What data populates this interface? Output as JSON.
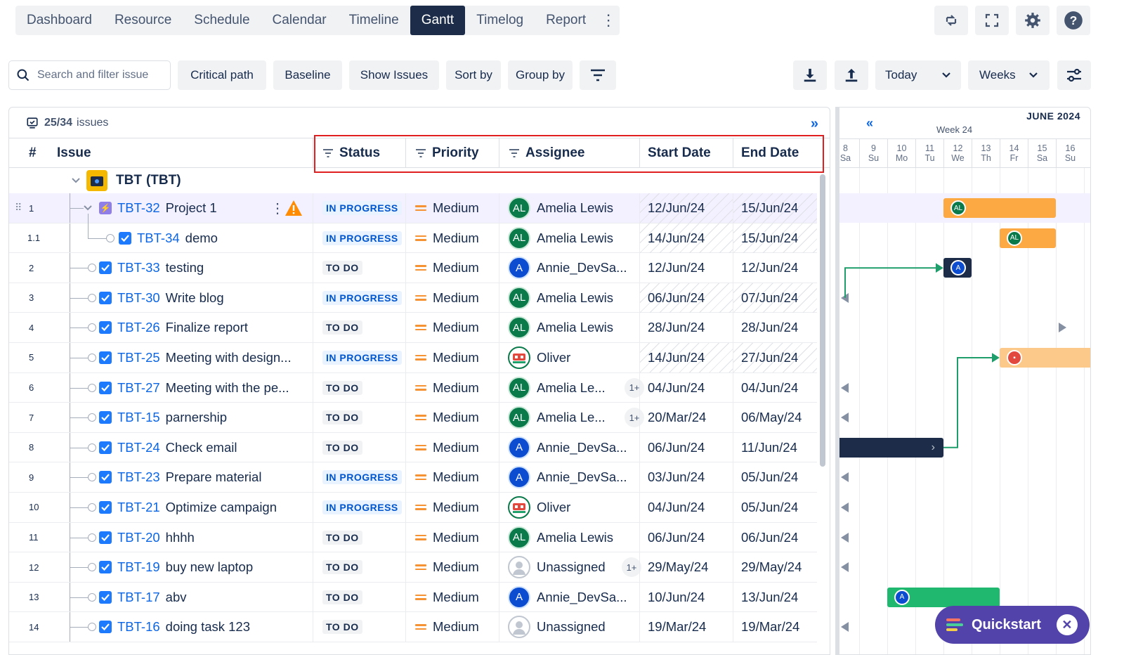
{
  "nav": {
    "tabs": [
      {
        "label": "Dashboard"
      },
      {
        "label": "Resource"
      },
      {
        "label": "Schedule"
      },
      {
        "label": "Calendar"
      },
      {
        "label": "Timeline"
      },
      {
        "label": "Gantt"
      },
      {
        "label": "Timelog"
      },
      {
        "label": "Report"
      }
    ],
    "active": "Gantt"
  },
  "toolbar": {
    "search_placeholder": "Search and filter issue",
    "critical_path": "Critical path",
    "baseline": "Baseline",
    "show_issues": "Show Issues",
    "sort_by": "Sort by",
    "group_by": "Group by",
    "today": "Today",
    "weeks": "Weeks"
  },
  "panel": {
    "count": "25/34",
    "count_suffix": "issues"
  },
  "columns": {
    "num": "#",
    "issue": "Issue",
    "status": "Status",
    "priority": "Priority",
    "assignee": "Assignee",
    "start": "Start Date",
    "end": "End Date"
  },
  "group": {
    "name": "TBT",
    "key": "(TBT)"
  },
  "rows": [
    {
      "num": "1",
      "key": "TBT-32",
      "title": "Project 1",
      "status": "IN PROGRESS",
      "priority": "Medium",
      "assignee": "Amelia Lewis",
      "initials": "AL",
      "start": "12/Jun/24",
      "end": "15/Jun/24"
    },
    {
      "num": "1.1",
      "key": "TBT-34",
      "title": "demo",
      "status": "IN PROGRESS",
      "priority": "Medium",
      "assignee": "Amelia Lewis",
      "initials": "AL",
      "start": "14/Jun/24",
      "end": "15/Jun/24"
    },
    {
      "num": "2",
      "key": "TBT-33",
      "title": "testing",
      "status": "TO DO",
      "priority": "Medium",
      "assignee": "Annie_DevSa...",
      "initials": "A",
      "start": "12/Jun/24",
      "end": "12/Jun/24"
    },
    {
      "num": "3",
      "key": "TBT-30",
      "title": "Write blog",
      "status": "IN PROGRESS",
      "priority": "Medium",
      "assignee": "Amelia Lewis",
      "initials": "AL",
      "start": "06/Jun/24",
      "end": "07/Jun/24"
    },
    {
      "num": "4",
      "key": "TBT-26",
      "title": "Finalize report",
      "status": "TO DO",
      "priority": "Medium",
      "assignee": "Amelia Lewis",
      "initials": "AL",
      "start": "28/Jun/24",
      "end": "28/Jun/24"
    },
    {
      "num": "5",
      "key": "TBT-25",
      "title": "Meeting with design...",
      "status": "IN PROGRESS",
      "priority": "Medium",
      "assignee": "Oliver",
      "initials": "",
      "start": "14/Jun/24",
      "end": "27/Jun/24"
    },
    {
      "num": "6",
      "key": "TBT-27",
      "title": "Meeting with the pe...",
      "status": "TO DO",
      "priority": "Medium",
      "assignee": "Amelia Le...",
      "initials": "AL",
      "extra": "1+",
      "start": "04/Jun/24",
      "end": "04/Jun/24"
    },
    {
      "num": "7",
      "key": "TBT-15",
      "title": "parnership",
      "status": "TO DO",
      "priority": "Medium",
      "assignee": "Amelia Le...",
      "initials": "AL",
      "extra": "1+",
      "start": "20/Mar/24",
      "end": "06/May/24"
    },
    {
      "num": "8",
      "key": "TBT-24",
      "title": "Check email",
      "status": "TO DO",
      "priority": "Medium",
      "assignee": "Annie_DevSa...",
      "initials": "A",
      "start": "06/Jun/24",
      "end": "11/Jun/24"
    },
    {
      "num": "9",
      "key": "TBT-23",
      "title": "Prepare material",
      "status": "IN PROGRESS",
      "priority": "Medium",
      "assignee": "Annie_DevSa...",
      "initials": "A",
      "start": "03/Jun/24",
      "end": "05/Jun/24"
    },
    {
      "num": "10",
      "key": "TBT-21",
      "title": "Optimize campaign",
      "status": "IN PROGRESS",
      "priority": "Medium",
      "assignee": "Oliver",
      "initials": "",
      "start": "04/Jun/24",
      "end": "05/Jun/24"
    },
    {
      "num": "11",
      "key": "TBT-20",
      "title": "hhhh",
      "status": "TO DO",
      "priority": "Medium",
      "assignee": "Amelia Lewis",
      "initials": "AL",
      "start": "06/Jun/24",
      "end": "06/Jun/24"
    },
    {
      "num": "12",
      "key": "TBT-19",
      "title": "buy new laptop",
      "status": "TO DO",
      "priority": "Medium",
      "assignee": "Unassigned",
      "initials": "",
      "extra": "1+",
      "start": "29/May/24",
      "end": "29/May/24"
    },
    {
      "num": "13",
      "key": "TBT-17",
      "title": "abv",
      "status": "TO DO",
      "priority": "Medium",
      "assignee": "Annie_DevSa...",
      "initials": "A",
      "start": "10/Jun/24",
      "end": "13/Jun/24"
    },
    {
      "num": "14",
      "key": "TBT-16",
      "title": "doing task 123",
      "status": "TO DO",
      "priority": "Medium",
      "assignee": "Unassigned",
      "initials": "",
      "start": "19/Mar/24",
      "end": "19/Mar/24"
    }
  ],
  "gantt": {
    "month": "JUNE 2024",
    "week": "Week 24",
    "days": [
      {
        "n": "8",
        "d": "Sa"
      },
      {
        "n": "9",
        "d": "Su"
      },
      {
        "n": "10",
        "d": "Mo"
      },
      {
        "n": "11",
        "d": "Tu"
      },
      {
        "n": "12",
        "d": "We"
      },
      {
        "n": "13",
        "d": "Th"
      },
      {
        "n": "14",
        "d": "Fr"
      },
      {
        "n": "15",
        "d": "Sa"
      },
      {
        "n": "16",
        "d": "Su"
      }
    ]
  },
  "quickstart": {
    "label": "Quickstart"
  },
  "colors": {
    "accent": "#0c66e4",
    "active_tab": "#1d2d49",
    "orange_bar": "#fca944",
    "green_bar": "#1fb86e",
    "navy_bar": "#1d2d49",
    "highlight": "#e02020"
  }
}
